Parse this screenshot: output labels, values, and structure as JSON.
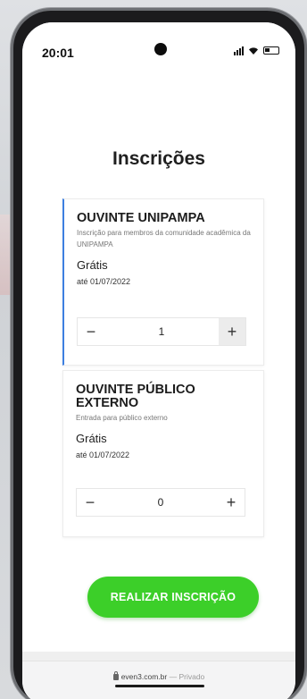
{
  "status_bar": {
    "time": "20:01"
  },
  "page": {
    "title": "Inscrições"
  },
  "tickets": [
    {
      "name": "OUVINTE UNIPAMPA",
      "description": "Inscrição para membros da comunidade acadêmica da UNIPAMPA",
      "price": "Grátis",
      "deadline": "até 01/07/2022",
      "quantity": "1",
      "minus": "−",
      "plus": "+"
    },
    {
      "name": "OUVINTE PÚBLICO EXTERNO",
      "description": "Entrada para público externo",
      "price": "Grátis",
      "deadline": "até 01/07/2022",
      "quantity": "0",
      "minus": "−",
      "plus": "+"
    }
  ],
  "register_button": {
    "label": "REALIZAR INSCRIÇÃO",
    "color": "#3ccf29"
  },
  "browser": {
    "domain": "even3.com.br",
    "separator": "—",
    "mode": "Privado"
  },
  "colors": {
    "selected_border": "#3d7fe0"
  }
}
